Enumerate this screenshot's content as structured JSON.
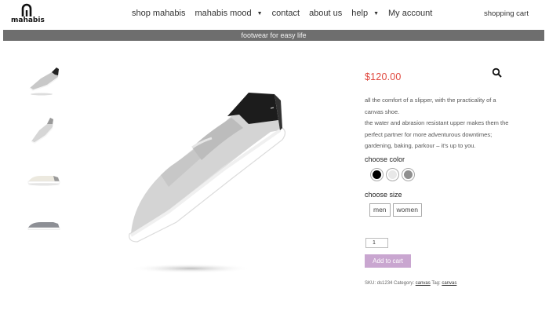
{
  "brand": {
    "name": "mahabis"
  },
  "nav": {
    "items": [
      {
        "label": "shop mahabis",
        "caret": false
      },
      {
        "label": "mahabis mood",
        "caret": true
      },
      {
        "label": "contact",
        "caret": false
      },
      {
        "label": "about us",
        "caret": false
      },
      {
        "label": "help",
        "caret": true
      },
      {
        "label": "My account",
        "caret": false
      }
    ],
    "cart_label": "shopping cart"
  },
  "banner": {
    "text": "footwear for easy life"
  },
  "product": {
    "price": "$120.00",
    "description": [
      "all the comfort of a slipper, with the practicality of a",
      "canvas shoe.",
      "the water and abrasion resistant upper makes them the",
      "perfect partner for more adventurous downtimes;",
      "gardening, baking, parkour – it's up to you."
    ],
    "color_label": "choose color",
    "colors": [
      {
        "name": "black",
        "hex": "#000000"
      },
      {
        "name": "white",
        "hex": "#e8e8e8"
      },
      {
        "name": "gray",
        "hex": "#8f8f8f"
      }
    ],
    "size_label": "choose size",
    "sizes": [
      "men",
      "women"
    ],
    "quantity": "1",
    "add_to_cart_label": "Add to cart",
    "meta": {
      "sku_label": "SKU:",
      "sku": "ds1234",
      "category_label": "Category:",
      "category": "canvas",
      "tag_label": "Tag:",
      "tag": "canvas"
    }
  },
  "icons": {
    "zoom": "search-icon",
    "caret": "chevron-down-icon"
  },
  "colors": {
    "accent_price": "#e0483e",
    "button": "#c9a6d0",
    "banner": "#6e6e6e"
  }
}
